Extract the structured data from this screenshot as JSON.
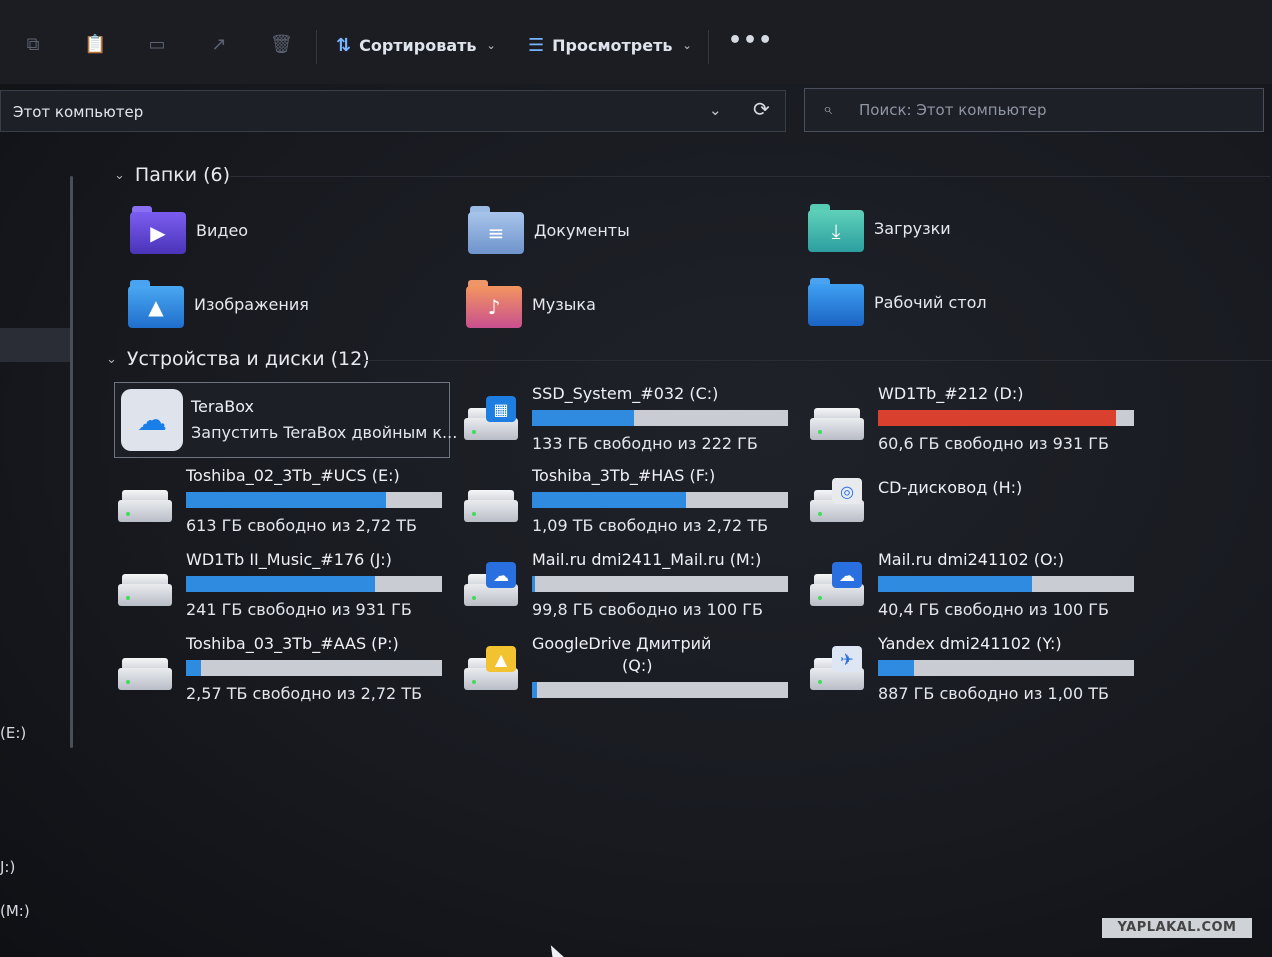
{
  "toolbar": {
    "sort_label": "Сортировать",
    "view_label": "Просмотреть",
    "more_label": "•••",
    "icons": [
      "copy-icon",
      "paste-icon",
      "rename-icon",
      "share-icon",
      "delete-icon"
    ]
  },
  "address": {
    "path": "Этот компьютер",
    "search_placeholder": "Поиск: Этот компьютер"
  },
  "nav": {
    "items": [
      "(E:)",
      "J:)",
      "(M:)"
    ]
  },
  "folders": {
    "header": "Папки (6)",
    "items": [
      {
        "label": "Видео",
        "icon": "video-folder-icon",
        "color": "#6b4fd6"
      },
      {
        "label": "Документы",
        "icon": "documents-folder-icon",
        "color": "#7aa3d8"
      },
      {
        "label": "Загрузки",
        "icon": "downloads-folder-icon",
        "color": "#3bb7a4"
      },
      {
        "label": "Изображения",
        "icon": "pictures-folder-icon",
        "color": "#2f8be0"
      },
      {
        "label": "Музыка",
        "icon": "music-folder-icon",
        "color": "#e87a4d"
      },
      {
        "label": "Рабочий стол",
        "icon": "desktop-folder-icon",
        "color": "#2f8be0"
      }
    ]
  },
  "devices": {
    "header": "Устройства и диски (12)",
    "terabox": {
      "name": "TeraBox",
      "subtitle": "Запустить TeraBox двойным к..."
    },
    "drives": [
      {
        "name": "SSD_System_#032 (C:)",
        "free": "133 ГБ свободно из 222 ГБ",
        "used_fraction": 0.4,
        "status": "normal",
        "icon": "windows-drive-icon"
      },
      {
        "name": "WD1Tb_#212 (D:)",
        "free": "60,6 ГБ свободно из 931 ГБ",
        "used_fraction": 0.93,
        "status": "critical",
        "icon": "hard-drive-icon"
      },
      {
        "name": "Toshiba_02_3Tb_#UCS (E:)",
        "free": "613 ГБ свободно из 2,72 ТБ",
        "used_fraction": 0.78,
        "status": "normal",
        "icon": "hard-drive-icon"
      },
      {
        "name": "Toshiba_3Tb_#HAS (F:)",
        "free": "1,09 ТБ свободно из 2,72 ТБ",
        "used_fraction": 0.6,
        "status": "normal",
        "icon": "hard-drive-icon"
      },
      {
        "name": "CD-дисковод (H:)",
        "free": "",
        "used_fraction": null,
        "status": "none",
        "icon": "cd-drive-icon"
      },
      {
        "name": "WD1Tb II_Music_#176 (J:)",
        "free": "241 ГБ свободно из 931 ГБ",
        "used_fraction": 0.74,
        "status": "normal",
        "icon": "hard-drive-icon"
      },
      {
        "name": "Mail.ru dmi2411_Mail.ru (M:)",
        "free": "99,8 ГБ свободно из 100 ГБ",
        "used_fraction": 0.01,
        "status": "normal",
        "icon": "mailru-cloud-drive-icon"
      },
      {
        "name": "Mail.ru dmi241102 (O:)",
        "free": "40,4 ГБ свободно из 100 ГБ",
        "used_fraction": 0.6,
        "status": "normal",
        "icon": "mailru-cloud-drive-icon"
      },
      {
        "name": "Toshiba_03_3Tb_#AAS (P:)",
        "free": "2,57 ТБ свободно из 2,72 ТБ",
        "used_fraction": 0.06,
        "status": "normal",
        "icon": "hard-drive-icon"
      },
      {
        "name": "GoogleDrive Дмитрий",
        "name2": "(Q:)",
        "free": "",
        "used_fraction": 0.02,
        "status": "normal",
        "icon": "google-drive-icon"
      },
      {
        "name": "Yandex dmi241102 (Y:)",
        "free": "887 ГБ свободно из 1,00 ТБ",
        "used_fraction": 0.14,
        "status": "normal",
        "icon": "yandex-disk-icon"
      }
    ]
  },
  "colors": {
    "bar_fill": "#2f8be0",
    "bar_fill_critical": "#d9412e",
    "bar_track": "#c9ccd2"
  },
  "watermark": "YAPLAKAL.COM"
}
